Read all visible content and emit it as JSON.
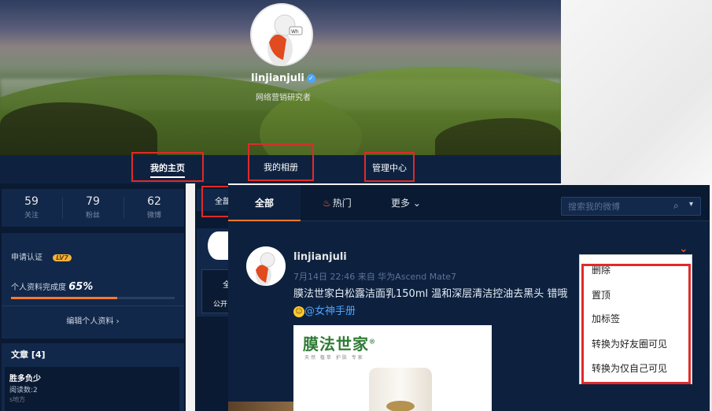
{
  "profile": {
    "username": "linjianjuli",
    "verified_icon": "verified-badge-icon",
    "bio": "网络营销研究者"
  },
  "nav": {
    "tabs": [
      {
        "label": "我的主页",
        "active": true
      },
      {
        "label": "我的相册",
        "active": false
      },
      {
        "label": "管理中心",
        "active": false
      }
    ]
  },
  "stats": [
    {
      "value": "59",
      "label": "关注"
    },
    {
      "value": "79",
      "label": "粉丝"
    },
    {
      "value": "62",
      "label": "微博"
    }
  ],
  "certification": {
    "label": "申请认证",
    "level": "LV7",
    "completion_label": "个人资料完成度",
    "completion_value": "65%",
    "completion_fraction": 0.65,
    "edit_label": "编辑个人资料 ›"
  },
  "articles": {
    "header": "文章 [4]",
    "item_title": "胜多负少",
    "item_reads": "阅读数:2",
    "item_source": "s地方"
  },
  "middle_peek": {
    "tab_label": "全部",
    "box_char": "全",
    "box_label": "公开"
  },
  "feed": {
    "tabs": [
      "全部",
      "热门",
      "更多 ⌄"
    ],
    "search_placeholder": "搜索我的微博",
    "post": {
      "user": "linjianjuli",
      "meta": "7月14日 22:46 来自 华为Ascend Mate7",
      "text": "膜法世家白松露洁面乳150ml 温和深层清洁控油去黑头 错哦",
      "mention": "@女神手册",
      "image_brand": "膜法世家",
      "image_brand_mark": "®",
      "image_subtitle": "天然 植萃 护肤 专家"
    }
  },
  "dropdown": {
    "items": [
      "删除",
      "置顶",
      "加标签",
      "转换为好友圈可见",
      "转换为仅自己可见"
    ]
  },
  "colors": {
    "accent_orange": "#ff7a2b",
    "highlight_red": "#e02a2a",
    "link_blue": "#4aa3ff",
    "panel_dark": "#0d213f"
  }
}
